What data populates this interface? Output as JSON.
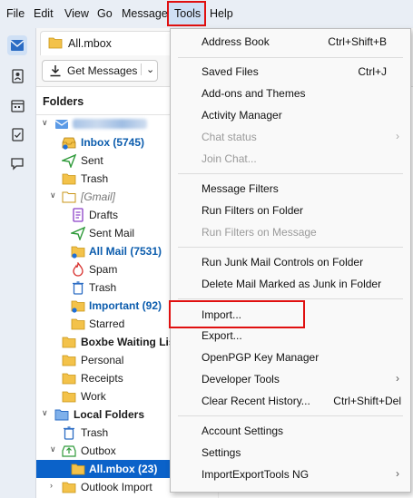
{
  "menubar": {
    "items": [
      "File",
      "Edit",
      "View",
      "Go",
      "Message",
      "Tools",
      "Help"
    ]
  },
  "tab": {
    "title": "All.mbox"
  },
  "toolbar": {
    "get_messages": "Get Messages"
  },
  "folder_pane": {
    "header": "Folders",
    "rows": [
      {
        "label": "",
        "blurred": true
      },
      {
        "label": "Inbox (5745)"
      },
      {
        "label": "Sent"
      },
      {
        "label": "Trash"
      },
      {
        "label": "[Gmail]"
      },
      {
        "label": "Drafts"
      },
      {
        "label": "Sent Mail"
      },
      {
        "label": "All Mail (7531)"
      },
      {
        "label": "Spam"
      },
      {
        "label": "Trash"
      },
      {
        "label": "Important (92)"
      },
      {
        "label": "Starred"
      },
      {
        "label": "Boxbe Waiting Lis"
      },
      {
        "label": "Personal"
      },
      {
        "label": "Receipts"
      },
      {
        "label": "Work"
      },
      {
        "label": "Local Folders"
      },
      {
        "label": "Trash"
      },
      {
        "label": "Outbox"
      },
      {
        "label": "All.mbox (23)"
      },
      {
        "label": "Outlook Import"
      }
    ]
  },
  "tools_menu": {
    "items": [
      {
        "label": "Address Book",
        "shortcut": "Ctrl+Shift+B"
      },
      {
        "label": "Saved Files",
        "shortcut": "Ctrl+J"
      },
      {
        "label": "Add-ons and Themes",
        "shortcut": ""
      },
      {
        "label": "Activity Manager",
        "shortcut": ""
      },
      {
        "label": "Chat status",
        "shortcut": ""
      },
      {
        "label": "Join Chat...",
        "shortcut": ""
      },
      {
        "label": "Message Filters",
        "shortcut": ""
      },
      {
        "label": "Run Filters on Folder",
        "shortcut": ""
      },
      {
        "label": "Run Filters on Message",
        "shortcut": ""
      },
      {
        "label": "Run Junk Mail Controls on Folder",
        "shortcut": ""
      },
      {
        "label": "Delete Mail Marked as Junk in Folder",
        "shortcut": ""
      },
      {
        "label": "Import...",
        "shortcut": ""
      },
      {
        "label": "Export...",
        "shortcut": ""
      },
      {
        "label": "OpenPGP Key Manager",
        "shortcut": ""
      },
      {
        "label": "Developer Tools",
        "shortcut": ""
      },
      {
        "label": "Clear Recent History...",
        "shortcut": "Ctrl+Shift+Del"
      },
      {
        "label": "Account Settings",
        "shortcut": ""
      },
      {
        "label": "Settings",
        "shortcut": ""
      },
      {
        "label": "ImportExportTools NG",
        "shortcut": ""
      }
    ]
  },
  "colors": {
    "highlight_red": "#e01010",
    "selected_blue": "#0b62c9",
    "unread_blue": "#0b5cad",
    "folder_yellow": "#f3c24a"
  }
}
